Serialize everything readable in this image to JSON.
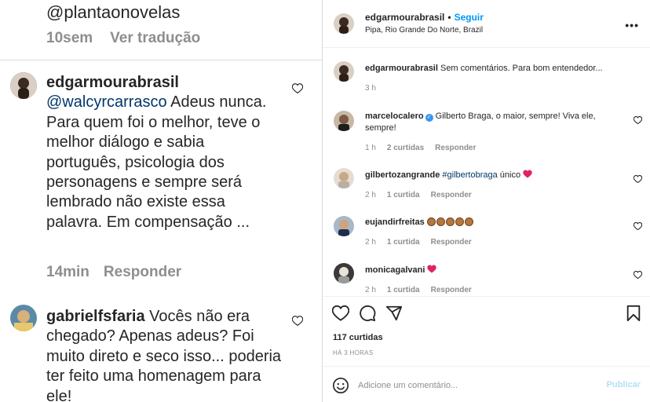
{
  "left": {
    "top_handle": "@plantaonovelas",
    "top_meta": {
      "time": "10sem",
      "translate": "Ver tradução"
    },
    "comment1": {
      "user": "edgarmourabrasil",
      "mention": "@walcyrcarrasco",
      "text": " Adeus nunca. Para quem foi o melhor, teve o melhor diálogo e sabia português, psicologia dos personagens e sempre será lembrado não existe essa palavra. Em compensação ...",
      "time": "14min",
      "reply": "Responder"
    },
    "comment2": {
      "user": "gabrielfsfaria",
      "text": " Vocês não era chegado? Apenas adeus? Foi muito direto e seco isso... poderia ter feito uma homenagem para ele!"
    }
  },
  "header": {
    "username": "edgarmourabrasil",
    "dot": "•",
    "follow": "Seguir",
    "location": "Pipa, Rio Grande Do Norte, Brazil",
    "more": "•••"
  },
  "caption": {
    "user": "edgarmourabrasil",
    "text": " Sem comentários. Para bom entendedor...",
    "time": "3 h"
  },
  "comments": [
    {
      "user": "marcelocalero",
      "text": " Gilberto Braga, o maior, sempre! Viva ele, sempre!",
      "time": "1 h",
      "likes": "2 curtidas",
      "reply": "Responder"
    },
    {
      "user": "gilbertozangrande",
      "tag": "#gilbertobraga",
      "text": " único",
      "time": "2 h",
      "likes": "1 curtida",
      "reply": "Responder"
    },
    {
      "user": "eujandirfreitas",
      "time": "2 h",
      "likes": "1 curtida",
      "reply": "Responder"
    },
    {
      "user": "monicagalvani",
      "time": "2 h",
      "likes": "1 curtida",
      "reply": "Responder"
    }
  ],
  "post": {
    "likes": "117 curtidas",
    "time": "HÁ 3 HORAS"
  },
  "add_comment": {
    "placeholder": "Adicione um comentário...",
    "publish": "Publicar"
  },
  "colors": {
    "link": "#0095f6",
    "mention": "#00376b",
    "muted": "#8e8e8e",
    "heart_red": "#ed4956",
    "border": "#dbdbdb"
  },
  "icons": [
    "heart-icon",
    "comment-icon",
    "share-icon",
    "bookmark-icon",
    "emoji-icon",
    "verified-icon",
    "more-icon"
  ]
}
